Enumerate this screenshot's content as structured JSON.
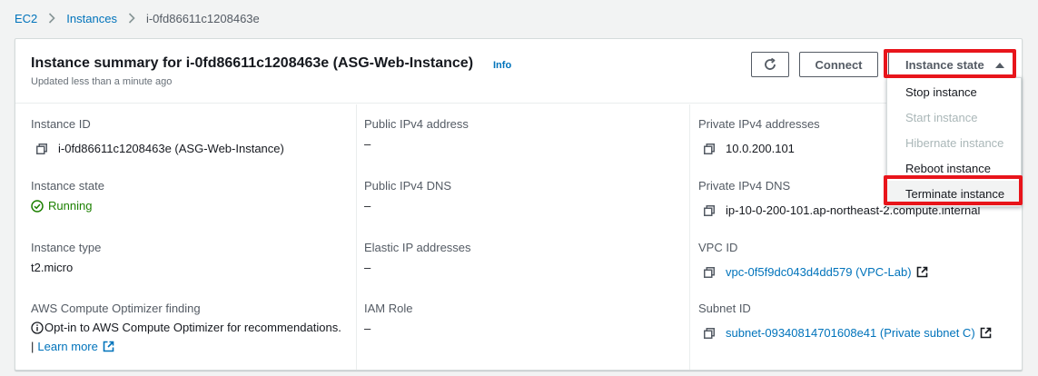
{
  "breadcrumb": {
    "items": [
      "EC2",
      "Instances"
    ],
    "current": "i-0fd86611c1208463e"
  },
  "header": {
    "title": "Instance summary for i-0fd86611c1208463e (ASG-Web-Instance)",
    "info": "Info",
    "subtitle": "Updated less than a minute ago",
    "connect_label": "Connect",
    "instance_state_label": "Instance state"
  },
  "dropdown": {
    "items": [
      {
        "label": "Stop instance",
        "disabled": false
      },
      {
        "label": "Start instance",
        "disabled": true
      },
      {
        "label": "Hibernate instance",
        "disabled": true
      },
      {
        "label": "Reboot instance",
        "disabled": false
      },
      {
        "label": "Terminate instance",
        "disabled": false
      }
    ]
  },
  "details": {
    "instance_id": {
      "label": "Instance ID",
      "value": "i-0fd86611c1208463e (ASG-Web-Instance)"
    },
    "instance_state": {
      "label": "Instance state",
      "value": "Running"
    },
    "instance_type": {
      "label": "Instance type",
      "value": "t2.micro"
    },
    "optimizer": {
      "label": "AWS Compute Optimizer finding",
      "text": "Opt-in to AWS Compute Optimizer for recommendations.",
      "separator": "|",
      "link": "Learn more"
    },
    "public_ipv4": {
      "label": "Public IPv4 address",
      "value": "–"
    },
    "public_dns": {
      "label": "Public IPv4 DNS",
      "value": "–"
    },
    "elastic_ip": {
      "label": "Elastic IP addresses",
      "value": "–"
    },
    "iam_role": {
      "label": "IAM Role",
      "value": "–"
    },
    "private_ipv4": {
      "label": "Private IPv4 addresses",
      "value": "10.0.200.101"
    },
    "private_dns": {
      "label": "Private IPv4 DNS",
      "value": "ip-10-0-200-101.ap-northeast-2.compute.internal"
    },
    "vpc_id": {
      "label": "VPC ID",
      "value": "vpc-0f5f9dc043d4dd579 (VPC-Lab)"
    },
    "subnet_id": {
      "label": "Subnet ID",
      "value": "subnet-09340814701608e41 (Private subnet C)"
    }
  },
  "colors": {
    "link": "#0073bb",
    "running": "#1d8102",
    "highlight": "#e8151b"
  },
  "icons": [
    "chevron-right-icon",
    "refresh-icon",
    "caret-up-icon",
    "copy-icon",
    "check-circle-icon",
    "info-circle-icon",
    "external-link-icon"
  ]
}
